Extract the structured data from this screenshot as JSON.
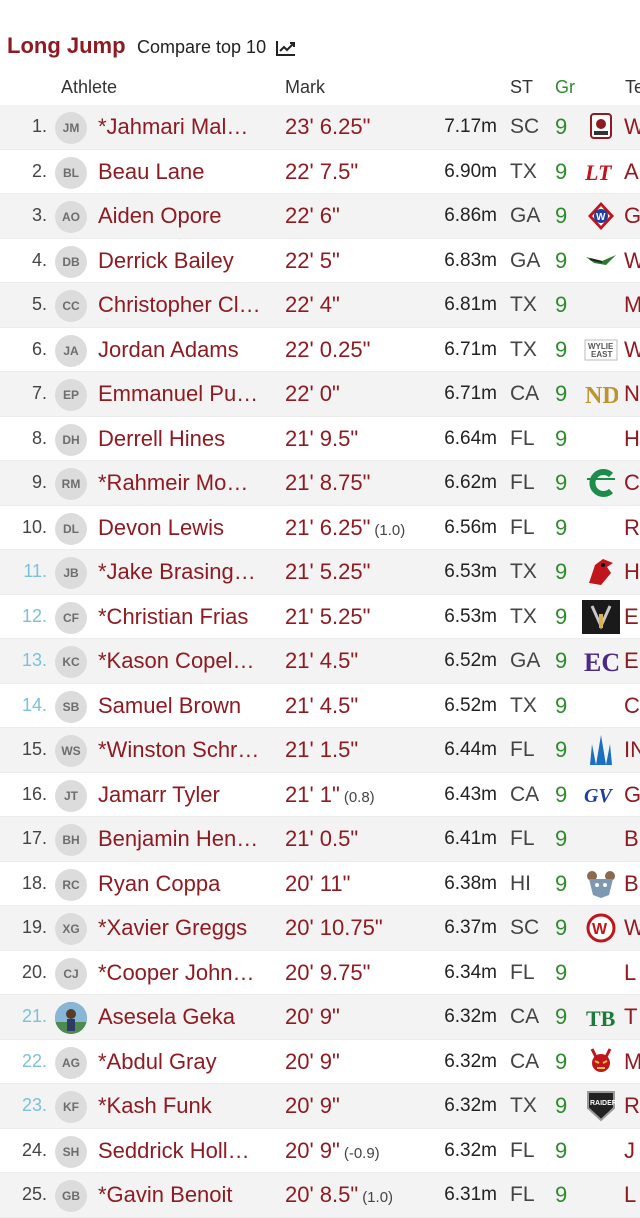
{
  "header": {
    "title": "Long Jump",
    "compare_label": "Compare top 10"
  },
  "columns": {
    "athlete": "Athlete",
    "mark": "Mark",
    "state": "ST",
    "grade": "Gr",
    "team": "Te"
  },
  "rows": [
    {
      "rank": "1.",
      "initials": "JM",
      "name": "*Jahmari Mal…",
      "mark": "23' 6.25\"",
      "wind": "",
      "metric": "7.17m",
      "st": "SC",
      "gr": "9",
      "team": "W",
      "logo": "crest-logo"
    },
    {
      "rank": "2.",
      "initials": "BL",
      "name": "Beau Lane",
      "mark": "22' 7.5\"",
      "wind": "",
      "metric": "6.90m",
      "st": "TX",
      "gr": "9",
      "team": "A",
      "logo": "lt-logo"
    },
    {
      "rank": "3.",
      "initials": "AO",
      "name": "Aiden Opore",
      "mark": "22' 6\"",
      "wind": "",
      "metric": "6.86m",
      "st": "GA",
      "gr": "9",
      "team": "G",
      "logo": "w-shield-logo"
    },
    {
      "rank": "4.",
      "initials": "DB",
      "name": "Derrick Bailey",
      "mark": "22' 5\"",
      "wind": "",
      "metric": "6.83m",
      "st": "GA",
      "gr": "9",
      "team": "W",
      "logo": "wing-logo"
    },
    {
      "rank": "5.",
      "initials": "CC",
      "name": "Christopher Cl…",
      "mark": "22' 4\"",
      "wind": "",
      "metric": "6.81m",
      "st": "TX",
      "gr": "9",
      "team": "M",
      "logo": ""
    },
    {
      "rank": "6.",
      "initials": "JA",
      "name": "Jordan Adams",
      "mark": "22' 0.25\"",
      "wind": "",
      "metric": "6.71m",
      "st": "TX",
      "gr": "9",
      "team": "W",
      "logo": "wylie-east-logo"
    },
    {
      "rank": "7.",
      "initials": "EP",
      "name": "Emmanuel Pu…",
      "mark": "22' 0\"",
      "wind": "",
      "metric": "6.71m",
      "st": "CA",
      "gr": "9",
      "team": "N",
      "logo": "nd-logo"
    },
    {
      "rank": "8.",
      "initials": "DH",
      "name": "Derrell Hines",
      "mark": "21' 9.5\"",
      "wind": "",
      "metric": "6.64m",
      "st": "FL",
      "gr": "9",
      "team": "H",
      "logo": ""
    },
    {
      "rank": "9.",
      "initials": "RM",
      "name": "*Rahmeir Mo…",
      "mark": "21' 8.75\"",
      "wind": "",
      "metric": "6.62m",
      "st": "FL",
      "gr": "9",
      "team": "C",
      "logo": "c-logo"
    },
    {
      "rank": "10.",
      "initials": "DL",
      "name": "Devon Lewis",
      "mark": "21' 6.25\"",
      "wind": "(1.0)",
      "metric": "6.56m",
      "st": "FL",
      "gr": "9",
      "team": "R",
      "logo": ""
    },
    {
      "rank": "11.",
      "initials": "JB",
      "name": "*Jake Brasing…",
      "mark": "21' 5.25\"",
      "wind": "",
      "metric": "6.53m",
      "st": "TX",
      "gr": "9",
      "team": "H",
      "logo": "cardinal-logo"
    },
    {
      "rank": "12.",
      "initials": "CF",
      "name": "*Christian Frias",
      "mark": "21' 5.25\"",
      "wind": "",
      "metric": "6.53m",
      "st": "TX",
      "gr": "9",
      "team": "E",
      "logo": "dark-logo"
    },
    {
      "rank": "13.",
      "initials": "KC",
      "name": "*Kason Copel…",
      "mark": "21' 4.5\"",
      "wind": "",
      "metric": "6.52m",
      "st": "GA",
      "gr": "9",
      "team": "E",
      "logo": "ec-logo"
    },
    {
      "rank": "14.",
      "initials": "SB",
      "name": "Samuel Brown",
      "mark": "21' 4.5\"",
      "wind": "",
      "metric": "6.52m",
      "st": "TX",
      "gr": "9",
      "team": "C",
      "logo": ""
    },
    {
      "rank": "15.",
      "initials": "WS",
      "name": "*Winston Schr…",
      "mark": "21' 1.5\"",
      "wind": "",
      "metric": "6.44m",
      "st": "FL",
      "gr": "9",
      "team": "IN",
      "logo": "spire-logo"
    },
    {
      "rank": "16.",
      "initials": "JT",
      "name": "Jamarr Tyler",
      "mark": "21' 1\"",
      "wind": "(0.8)",
      "metric": "6.43m",
      "st": "CA",
      "gr": "9",
      "team": "G",
      "logo": "gv-logo"
    },
    {
      "rank": "17.",
      "initials": "BH",
      "name": "Benjamin Hen…",
      "mark": "21' 0.5\"",
      "wind": "",
      "metric": "6.41m",
      "st": "FL",
      "gr": "9",
      "team": "B",
      "logo": ""
    },
    {
      "rank": "18.",
      "initials": "RC",
      "name": "Ryan Coppa",
      "mark": "20' 11\"",
      "wind": "",
      "metric": "6.38m",
      "st": "HI",
      "gr": "9",
      "team": "B",
      "logo": "bear-logo"
    },
    {
      "rank": "19.",
      "initials": "XG",
      "name": "*Xavier Greggs",
      "mark": "20' 10.75\"",
      "wind": "",
      "metric": "6.37m",
      "st": "SC",
      "gr": "9",
      "team": "W",
      "logo": "w-circle-logo"
    },
    {
      "rank": "20.",
      "initials": "CJ",
      "name": "*Cooper John…",
      "mark": "20' 9.75\"",
      "wind": "",
      "metric": "6.34m",
      "st": "FL",
      "gr": "9",
      "team": "L",
      "logo": ""
    },
    {
      "rank": "21.",
      "initials": "",
      "name": "Asesela Geka",
      "mark": "20' 9\"",
      "wind": "",
      "metric": "6.32m",
      "st": "CA",
      "gr": "9",
      "team": "T",
      "logo": "tb-logo"
    },
    {
      "rank": "22.",
      "initials": "AG",
      "name": "*Abdul Gray",
      "mark": "20' 9\"",
      "wind": "",
      "metric": "6.32m",
      "st": "CA",
      "gr": "9",
      "team": "M",
      "logo": "devil-logo"
    },
    {
      "rank": "23.",
      "initials": "KF",
      "name": "*Kash Funk",
      "mark": "20' 9\"",
      "wind": "",
      "metric": "6.32m",
      "st": "TX",
      "gr": "9",
      "team": "R",
      "logo": "raiders-logo"
    },
    {
      "rank": "24.",
      "initials": "SH",
      "name": "Seddrick Holl…",
      "mark": "20' 9\"",
      "wind": "(-0.9)",
      "metric": "6.32m",
      "st": "FL",
      "gr": "9",
      "team": "J",
      "logo": ""
    },
    {
      "rank": "25.",
      "initials": "GB",
      "name": "*Gavin Benoit",
      "mark": "20' 8.5\"",
      "wind": "(1.0)",
      "metric": "6.31m",
      "st": "FL",
      "gr": "9",
      "team": "L",
      "logo": ""
    }
  ]
}
